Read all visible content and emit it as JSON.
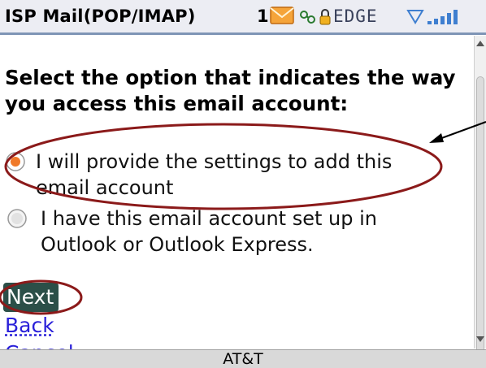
{
  "status_bar": {
    "app_title": "ISP Mail(POP/IMAP)",
    "message_count": "1",
    "network": "EDGE",
    "icons": [
      "envelope-icon",
      "bluetooth-icon",
      "lock-icon",
      "wifi-icon",
      "signal-bars-icon"
    ]
  },
  "form": {
    "heading": "Select the option that indicates the way you access this email account:",
    "options": [
      {
        "line1": "I will provide the settings to add this",
        "line2": "email account",
        "selected": true
      },
      {
        "line1": "I have this email account set up in",
        "line2": "Outlook or Outlook Express.",
        "selected": false
      }
    ],
    "next_label": "Next",
    "back_label": "Back",
    "cancel_label": "Cancel"
  },
  "footer": {
    "carrier": "AT&T"
  },
  "colors": {
    "status_bg": "#ecedf3",
    "accent_border": "#7f95b6",
    "next_bg": "#2b4f48",
    "link": "#2a20d9",
    "annotation": "#8b1a1a",
    "radio_selected": "#f07a2a"
  }
}
